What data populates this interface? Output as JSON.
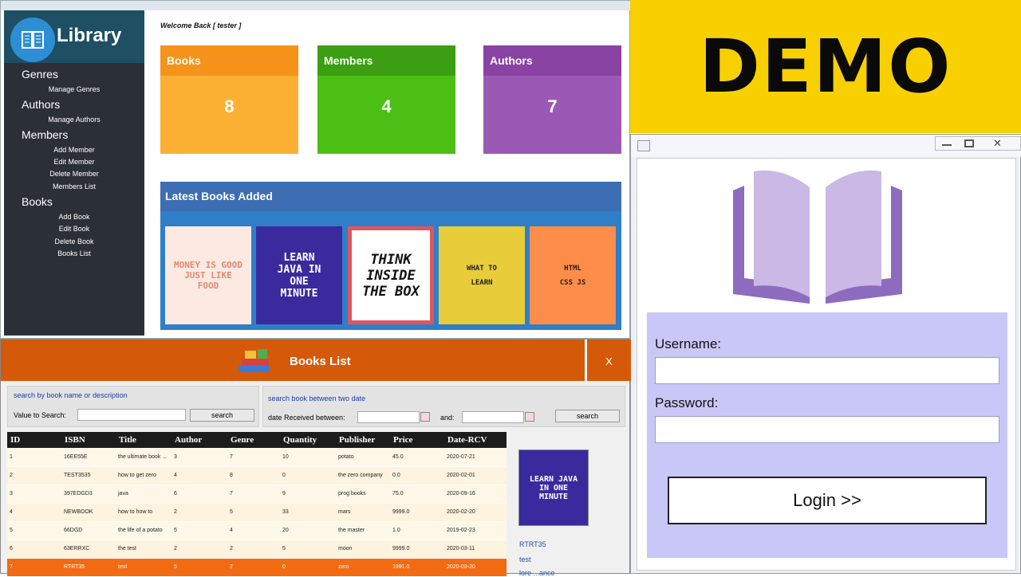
{
  "dashboard": {
    "logo_text": "Library",
    "welcome": "Welcome Back [ tester ]",
    "sidebar": {
      "genres": "Genres",
      "manage_genres": "Manage Genres",
      "authors": "Authors",
      "manage_authors": "Manage Authors",
      "members": "Members",
      "add_member": "Add Member",
      "edit_member": "Edit Member",
      "delete_member": "Delete Member",
      "members_list": "Members List",
      "books": "Books",
      "add_book": "Add Book",
      "edit_book": "Edit Book",
      "delete_book": "Delete Book",
      "books_list": "Books List"
    },
    "cards": [
      {
        "label": "Books",
        "value": "8",
        "header_color": "#f5931a",
        "body_color": "#fbb034"
      },
      {
        "label": "Members",
        "value": "4",
        "header_color": "#3c9e12",
        "body_color": "#4cbf15"
      },
      {
        "label": "Authors",
        "value": "7",
        "header_color": "#8843a3",
        "body_color": "#9b59b6"
      }
    ],
    "latest_title": "Latest Books Added",
    "covers": [
      {
        "text": "MONEY IS GOOD JUST LIKE FOOD",
        "bg": "#fbe9e2",
        "fg": "#e28a72"
      },
      {
        "text": "LEARN JAVA IN ONE MINUTE",
        "bg": "#3a2a9e",
        "fg": "#ffffff"
      },
      {
        "text": "THINK INSIDE THE BOX",
        "bg": "#ffffff",
        "fg": "#111111"
      },
      {
        "text": "WHAT TO LEARN",
        "bg": "#e8cc3a",
        "fg": "#222222"
      },
      {
        "text": "HTML CSS JS",
        "bg": "#ff8d4a",
        "fg": "#222222"
      }
    ]
  },
  "demo_banner": "DEMO",
  "login": {
    "username_label": "Username:",
    "username_value": "",
    "password_label": "Password:",
    "password_value": "",
    "login_button": "Login >>"
  },
  "books_list": {
    "title": "Books List",
    "close": "X",
    "search_by_name_label": "search by book name or description",
    "value_to_search_label": "Value to Search:",
    "search_button": "search",
    "date_search_label": "search book between two date",
    "date_received_label": "date Received between:",
    "and_label": "and:",
    "columns": [
      "ID",
      "ISBN",
      "Title",
      "Author",
      "Genre",
      "Quantity",
      "Publisher",
      "Price",
      "Date-RCV"
    ],
    "rows": [
      [
        "1",
        "16EE55E",
        "the ultimate book ...",
        "3",
        "7",
        "10",
        "potato",
        "45.0",
        "2020-07-21"
      ],
      [
        "2",
        "TEST3535",
        "how to get zero",
        "4",
        "8",
        "0",
        "the zero company",
        "0.0",
        "2020-02-01"
      ],
      [
        "3",
        "397EDGD3",
        "java",
        "6",
        "7",
        "9",
        "prog books",
        "75.0",
        "2020-09-16"
      ],
      [
        "4",
        "NEWBOOK",
        "how to how to",
        "2",
        "5",
        "33",
        "mars",
        "9999.0",
        "2020-02-20"
      ],
      [
        "5",
        "66DGD",
        "the life of a potato",
        "5",
        "4",
        "20",
        "the master",
        "1.0",
        "2019-02-23"
      ],
      [
        "6",
        "63ERRXC",
        "the test",
        "2",
        "2",
        "5",
        "moon",
        "9999.0",
        "2020-03-11"
      ],
      [
        "7",
        "RTRT35",
        "test",
        "5",
        "2",
        "0",
        "zero",
        "1991.0",
        "2020-03-20"
      ]
    ],
    "selected_isbn": "RTRT35",
    "selected_title": "test",
    "selected_extra": "lore ...ance",
    "thumb_text": "LEARN JAVA IN ONE MINUTE"
  }
}
